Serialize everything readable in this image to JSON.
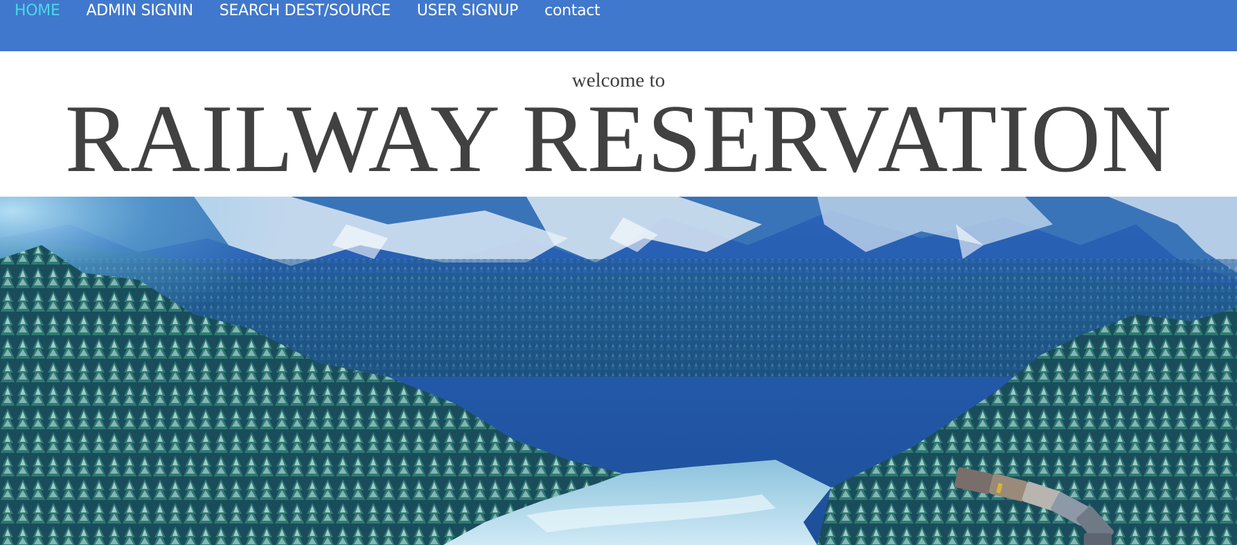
{
  "nav": {
    "items": [
      {
        "label": "HOME",
        "active": true
      },
      {
        "label": "ADMIN SIGNIN",
        "active": false
      },
      {
        "label": "SEARCH DEST/SOURCE",
        "active": false
      },
      {
        "label": "USER SIGNUP",
        "active": false
      },
      {
        "label": "contact",
        "active": false
      }
    ],
    "bar_color": "#4078cd",
    "active_color": "#4bd8e8"
  },
  "header": {
    "welcome": "welcome to",
    "title": "RAILWAY RESERVATION"
  },
  "hero": {
    "image": "snowy-mountain-forest-train-photo"
  }
}
